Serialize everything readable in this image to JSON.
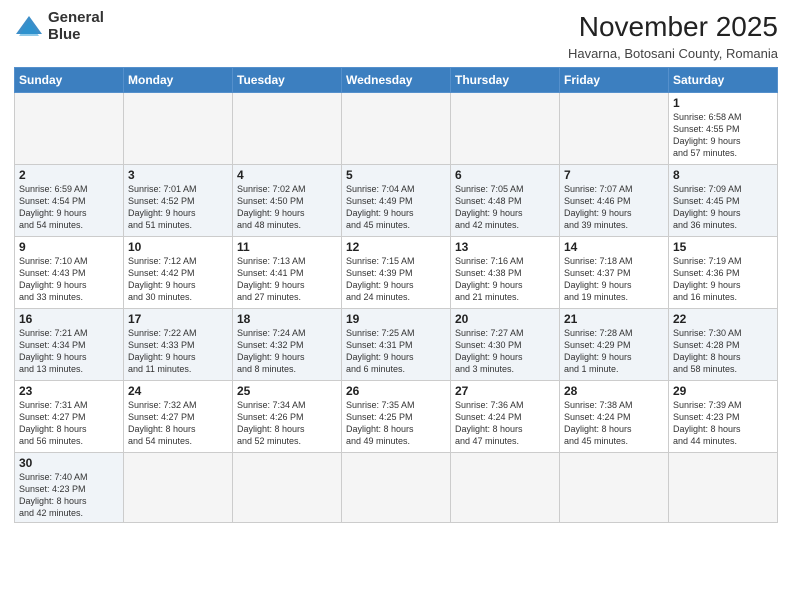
{
  "logo": {
    "line1": "General",
    "line2": "Blue"
  },
  "title": "November 2025",
  "subtitle": "Havarna, Botosani County, Romania",
  "weekdays": [
    "Sunday",
    "Monday",
    "Tuesday",
    "Wednesday",
    "Thursday",
    "Friday",
    "Saturday"
  ],
  "weeks": [
    [
      {
        "day": "",
        "info": ""
      },
      {
        "day": "",
        "info": ""
      },
      {
        "day": "",
        "info": ""
      },
      {
        "day": "",
        "info": ""
      },
      {
        "day": "",
        "info": ""
      },
      {
        "day": "",
        "info": ""
      },
      {
        "day": "1",
        "info": "Sunrise: 6:58 AM\nSunset: 4:55 PM\nDaylight: 9 hours\nand 57 minutes."
      }
    ],
    [
      {
        "day": "2",
        "info": "Sunrise: 6:59 AM\nSunset: 4:54 PM\nDaylight: 9 hours\nand 54 minutes."
      },
      {
        "day": "3",
        "info": "Sunrise: 7:01 AM\nSunset: 4:52 PM\nDaylight: 9 hours\nand 51 minutes."
      },
      {
        "day": "4",
        "info": "Sunrise: 7:02 AM\nSunset: 4:50 PM\nDaylight: 9 hours\nand 48 minutes."
      },
      {
        "day": "5",
        "info": "Sunrise: 7:04 AM\nSunset: 4:49 PM\nDaylight: 9 hours\nand 45 minutes."
      },
      {
        "day": "6",
        "info": "Sunrise: 7:05 AM\nSunset: 4:48 PM\nDaylight: 9 hours\nand 42 minutes."
      },
      {
        "day": "7",
        "info": "Sunrise: 7:07 AM\nSunset: 4:46 PM\nDaylight: 9 hours\nand 39 minutes."
      },
      {
        "day": "8",
        "info": "Sunrise: 7:09 AM\nSunset: 4:45 PM\nDaylight: 9 hours\nand 36 minutes."
      }
    ],
    [
      {
        "day": "9",
        "info": "Sunrise: 7:10 AM\nSunset: 4:43 PM\nDaylight: 9 hours\nand 33 minutes."
      },
      {
        "day": "10",
        "info": "Sunrise: 7:12 AM\nSunset: 4:42 PM\nDaylight: 9 hours\nand 30 minutes."
      },
      {
        "day": "11",
        "info": "Sunrise: 7:13 AM\nSunset: 4:41 PM\nDaylight: 9 hours\nand 27 minutes."
      },
      {
        "day": "12",
        "info": "Sunrise: 7:15 AM\nSunset: 4:39 PM\nDaylight: 9 hours\nand 24 minutes."
      },
      {
        "day": "13",
        "info": "Sunrise: 7:16 AM\nSunset: 4:38 PM\nDaylight: 9 hours\nand 21 minutes."
      },
      {
        "day": "14",
        "info": "Sunrise: 7:18 AM\nSunset: 4:37 PM\nDaylight: 9 hours\nand 19 minutes."
      },
      {
        "day": "15",
        "info": "Sunrise: 7:19 AM\nSunset: 4:36 PM\nDaylight: 9 hours\nand 16 minutes."
      }
    ],
    [
      {
        "day": "16",
        "info": "Sunrise: 7:21 AM\nSunset: 4:34 PM\nDaylight: 9 hours\nand 13 minutes."
      },
      {
        "day": "17",
        "info": "Sunrise: 7:22 AM\nSunset: 4:33 PM\nDaylight: 9 hours\nand 11 minutes."
      },
      {
        "day": "18",
        "info": "Sunrise: 7:24 AM\nSunset: 4:32 PM\nDaylight: 9 hours\nand 8 minutes."
      },
      {
        "day": "19",
        "info": "Sunrise: 7:25 AM\nSunset: 4:31 PM\nDaylight: 9 hours\nand 6 minutes."
      },
      {
        "day": "20",
        "info": "Sunrise: 7:27 AM\nSunset: 4:30 PM\nDaylight: 9 hours\nand 3 minutes."
      },
      {
        "day": "21",
        "info": "Sunrise: 7:28 AM\nSunset: 4:29 PM\nDaylight: 9 hours\nand 1 minute."
      },
      {
        "day": "22",
        "info": "Sunrise: 7:30 AM\nSunset: 4:28 PM\nDaylight: 8 hours\nand 58 minutes."
      }
    ],
    [
      {
        "day": "23",
        "info": "Sunrise: 7:31 AM\nSunset: 4:27 PM\nDaylight: 8 hours\nand 56 minutes."
      },
      {
        "day": "24",
        "info": "Sunrise: 7:32 AM\nSunset: 4:27 PM\nDaylight: 8 hours\nand 54 minutes."
      },
      {
        "day": "25",
        "info": "Sunrise: 7:34 AM\nSunset: 4:26 PM\nDaylight: 8 hours\nand 52 minutes."
      },
      {
        "day": "26",
        "info": "Sunrise: 7:35 AM\nSunset: 4:25 PM\nDaylight: 8 hours\nand 49 minutes."
      },
      {
        "day": "27",
        "info": "Sunrise: 7:36 AM\nSunset: 4:24 PM\nDaylight: 8 hours\nand 47 minutes."
      },
      {
        "day": "28",
        "info": "Sunrise: 7:38 AM\nSunset: 4:24 PM\nDaylight: 8 hours\nand 45 minutes."
      },
      {
        "day": "29",
        "info": "Sunrise: 7:39 AM\nSunset: 4:23 PM\nDaylight: 8 hours\nand 44 minutes."
      }
    ],
    [
      {
        "day": "30",
        "info": "Sunrise: 7:40 AM\nSunset: 4:23 PM\nDaylight: 8 hours\nand 42 minutes."
      },
      {
        "day": "",
        "info": ""
      },
      {
        "day": "",
        "info": ""
      },
      {
        "day": "",
        "info": ""
      },
      {
        "day": "",
        "info": ""
      },
      {
        "day": "",
        "info": ""
      },
      {
        "day": "",
        "info": ""
      }
    ]
  ]
}
